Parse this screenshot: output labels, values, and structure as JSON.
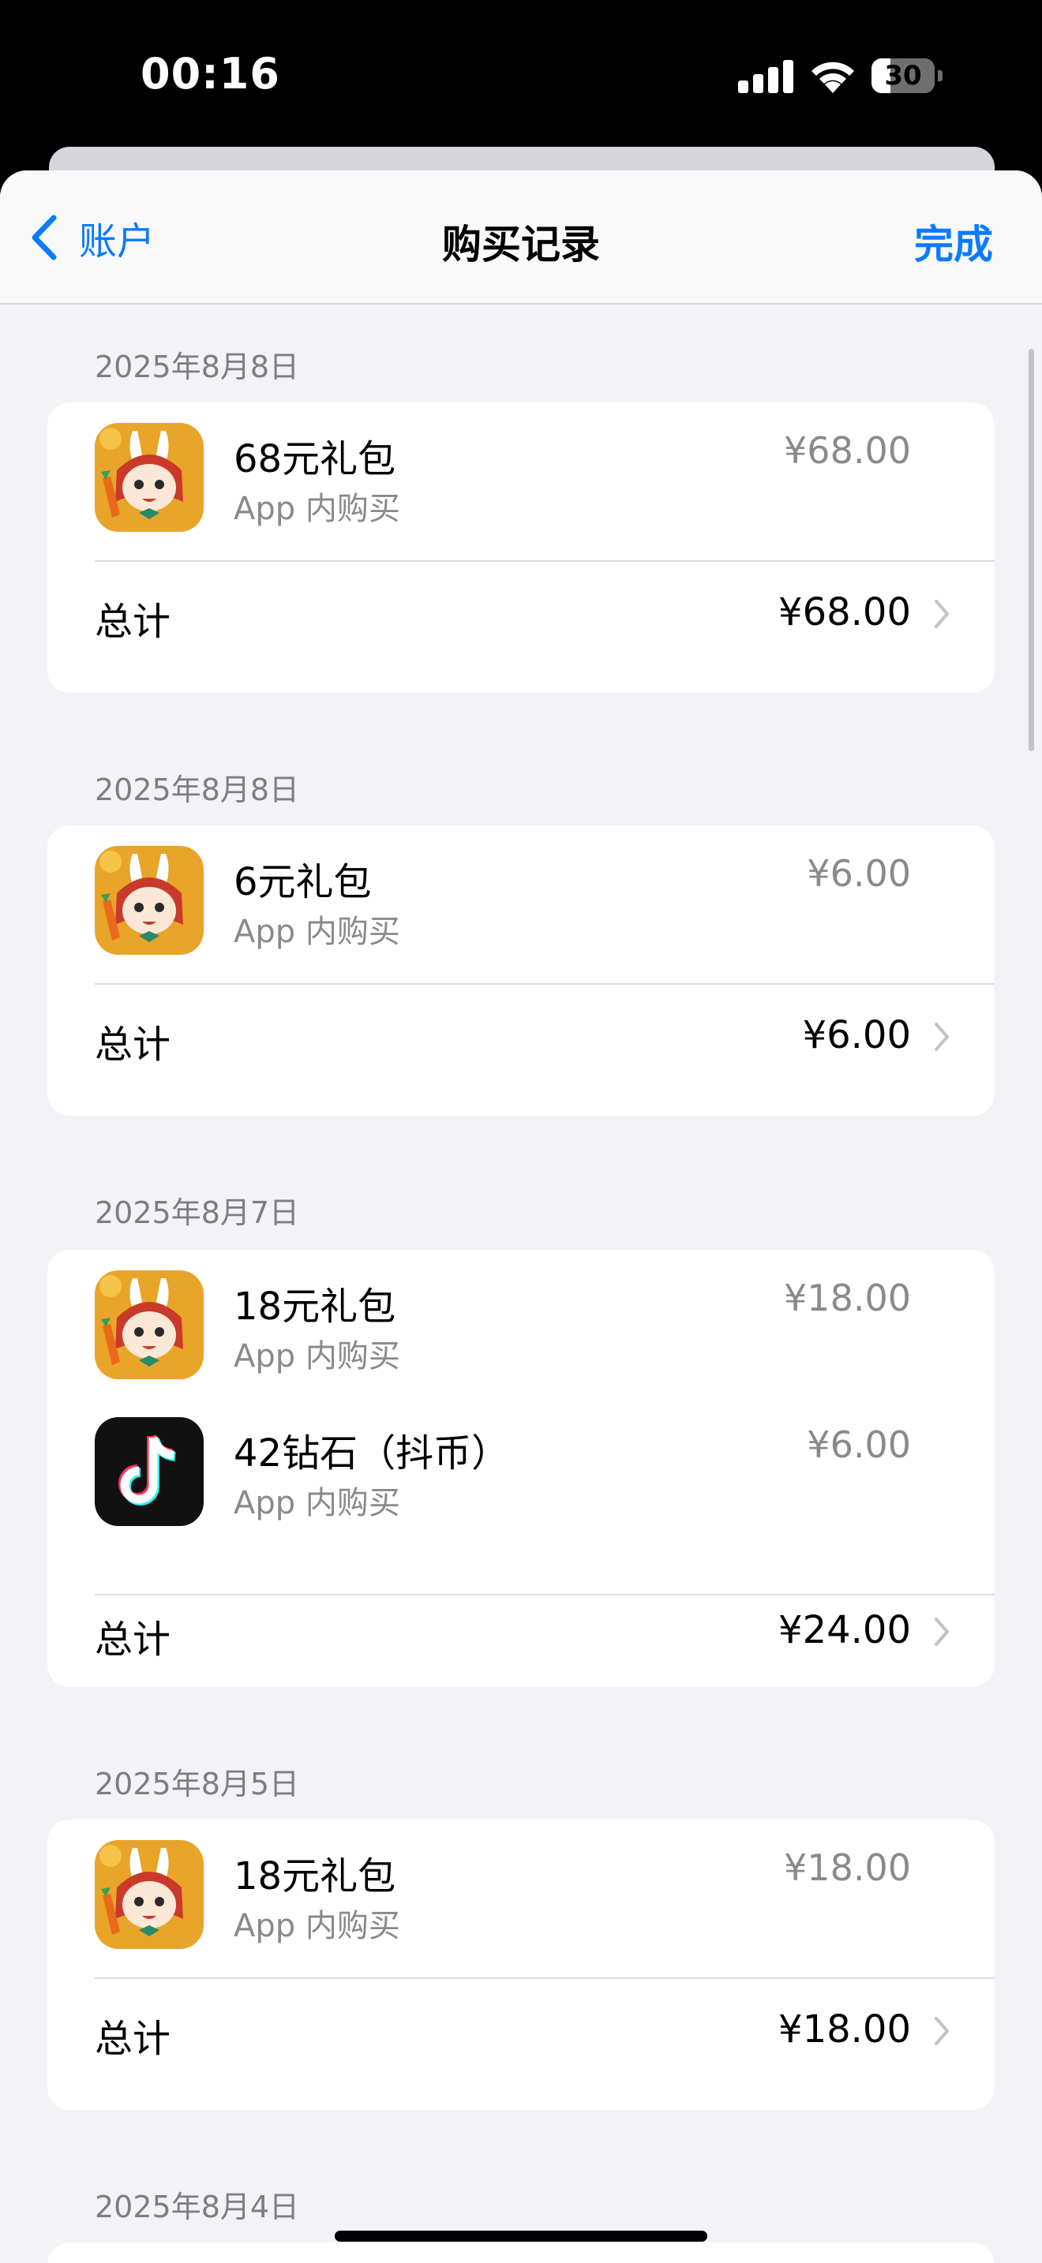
{
  "status": {
    "time": "00:16",
    "battery": "30",
    "battery_level": 0.3
  },
  "nav": {
    "back_label": "账户",
    "title": "购买记录",
    "done_label": "完成"
  },
  "sections": [
    {
      "date": "2025年8月8日",
      "items": [
        {
          "app": "bunny-game",
          "name": "68元礼包",
          "sub": "App 内购买",
          "price": "¥68.00"
        }
      ],
      "total_label": "总计",
      "total": "¥68.00"
    },
    {
      "date": "2025年8月8日",
      "items": [
        {
          "app": "bunny-game",
          "name": "6元礼包",
          "sub": "App 内购买",
          "price": "¥6.00"
        }
      ],
      "total_label": "总计",
      "total": "¥6.00"
    },
    {
      "date": "2025年8月7日",
      "items": [
        {
          "app": "bunny-game",
          "name": "18元礼包",
          "sub": "App 内购买",
          "price": "¥18.00"
        },
        {
          "app": "tiktok",
          "name": "42钻石（抖币）",
          "sub": "App 内购买",
          "price": "¥6.00"
        }
      ],
      "total_label": "总计",
      "total": "¥24.00"
    },
    {
      "date": "2025年8月5日",
      "items": [
        {
          "app": "bunny-game",
          "name": "18元礼包",
          "sub": "App 内购买",
          "price": "¥18.00"
        }
      ],
      "total_label": "总计",
      "total": "¥18.00"
    },
    {
      "date": "2025年8月4日",
      "items": [],
      "total_label": "",
      "total": ""
    }
  ],
  "colors": {
    "accent": "#0a7aff",
    "background": "#f2f2f7",
    "secondary_text": "#8a8a8e"
  },
  "icons": [
    "chevron-left-icon",
    "chevron-right-icon",
    "signal-icon",
    "wifi-icon",
    "battery-icon"
  ]
}
